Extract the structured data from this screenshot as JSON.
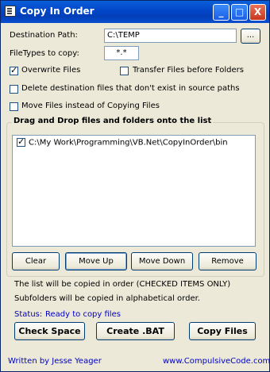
{
  "window": {
    "title": "Copy In Order"
  },
  "titlebar_buttons": {
    "minimize": "_",
    "maximize": "□",
    "close": "X"
  },
  "destination": {
    "label": "Destination Path:",
    "value": "C:\\TEMP",
    "browse_label": "..."
  },
  "filetypes": {
    "label": "FileTypes to copy:",
    "value": "*.*"
  },
  "options": {
    "overwrite": {
      "label": "Overwrite Files",
      "checked": true
    },
    "transfer_first": {
      "label": "Transfer Files before Folders",
      "checked": false
    },
    "delete_dest": {
      "label": "Delete destination files that don't exist in source paths",
      "checked": false
    },
    "move_files": {
      "label": "Move Files instead of Copying Files",
      "checked": false
    }
  },
  "list_group": {
    "title": "Drag and Drop files and folders onto the list",
    "items": [
      {
        "path": "C:\\My Work\\Programming\\VB.Net\\CopyInOrder\\bin",
        "checked": true
      }
    ]
  },
  "list_buttons": {
    "clear": "Clear",
    "move_up": "Move Up",
    "move_down": "Move Down",
    "remove": "Remove"
  },
  "notes": {
    "line1": "The list will be copied in order (CHECKED ITEMS ONLY)",
    "line2": "Subfolders will be copied in alphabetical order."
  },
  "status": {
    "label": "Status:",
    "value": "Ready to copy files"
  },
  "actions": {
    "check_space": "Check Space",
    "create_bat": "Create .BAT",
    "copy_files": "Copy Files"
  },
  "footer": {
    "author": "Written by Jesse Yeager",
    "website": "www.CompulsiveCode.com"
  }
}
